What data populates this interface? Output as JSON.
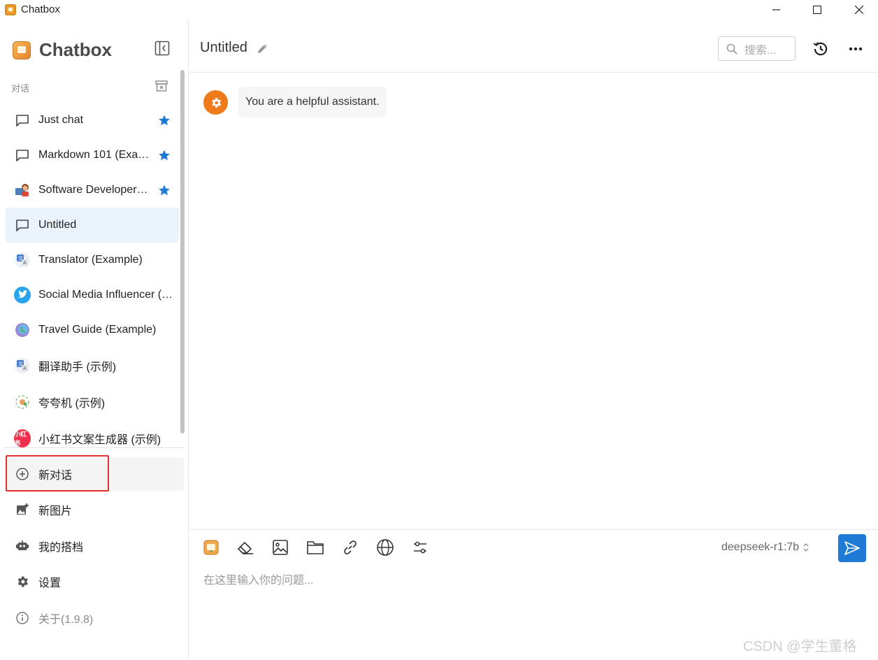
{
  "window": {
    "title": "Chatbox"
  },
  "sidebar": {
    "brand": "Chatbox",
    "section_label": "对话",
    "conversations": [
      {
        "label": "Just chat",
        "icon": "chat-bubble-icon",
        "starred": true
      },
      {
        "label": "Markdown 101 (Example)",
        "icon": "chat-bubble-icon",
        "starred": true
      },
      {
        "label": "Software Developer (Example)",
        "icon": "developer-avatar-icon",
        "starred": true
      },
      {
        "label": "Untitled",
        "icon": "chat-bubble-icon",
        "starred": false,
        "selected": true
      },
      {
        "label": "Translator (Example)",
        "icon": "translate-avatar-icon",
        "starred": false
      },
      {
        "label": "Social Media Influencer (Example)",
        "icon": "twitter-avatar-icon",
        "starred": false
      },
      {
        "label": "Travel Guide (Example)",
        "icon": "globe-avatar-icon",
        "starred": false
      },
      {
        "label": "翻译助手 (示例)",
        "icon": "translate-avatar-icon",
        "starred": false
      },
      {
        "label": "夸夸机 (示例)",
        "icon": "sparkle-avatar-icon",
        "starred": false
      },
      {
        "label": "小红书文案生成器 (示例)",
        "icon": "xiaohongshu-avatar-icon",
        "starred": false,
        "avatar_text": "小红书"
      }
    ],
    "bottom": {
      "new_chat": "新对话",
      "new_image": "新图片",
      "my_copilots": "我的搭档",
      "settings": "设置",
      "about": "关于(1.9.8)"
    }
  },
  "header": {
    "session_title": "Untitled",
    "search_placeholder": "搜索..."
  },
  "messages": [
    {
      "role": "system",
      "text": "You are a helpful assistant."
    }
  ],
  "input": {
    "model": "deepseek-r1:7b",
    "placeholder": "在这里输入你的问题..."
  },
  "watermark": "CSDN @学生董格",
  "colors": {
    "accent": "#1f7ad6",
    "star": "#1f7ad6",
    "system_avatar": "#ef7a1a",
    "highlight": "#e23030",
    "selected_bg": "#eaf2fb"
  }
}
